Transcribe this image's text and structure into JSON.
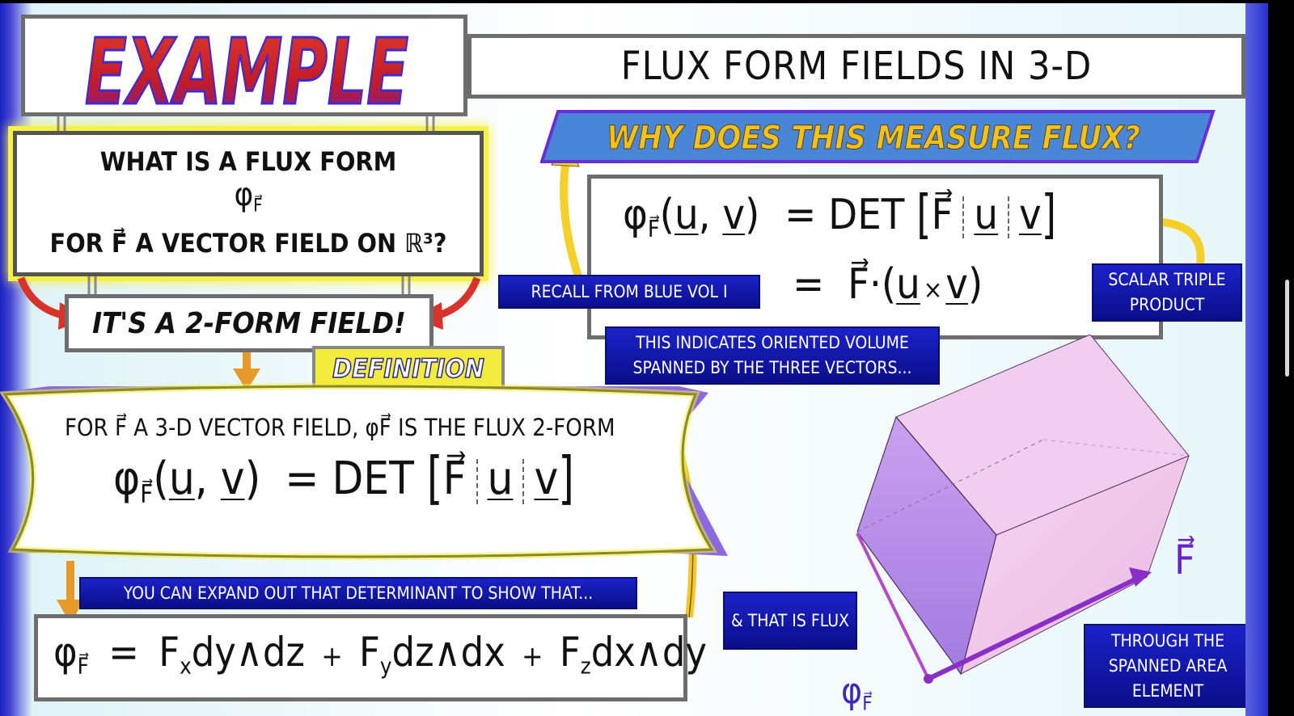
{
  "title_banner": {
    "logo_word": "EXAMPLE",
    "title": "FLUX FORM FIELDS IN 3-D"
  },
  "question": {
    "line1": "WHAT IS A FLUX FORM",
    "symbol": "φ",
    "symbol_sub": "F⃗",
    "line3": "FOR F⃗ A VECTOR FIELD ON ℝ³?"
  },
  "answer": "IT'S A 2-FORM FIELD!",
  "definition_tag": "DEFINITION",
  "definition": {
    "sentence": "FOR F⃗ A 3-D VECTOR FIELD, φF⃗ IS THE FLUX 2-FORM",
    "formula_lhs": "φ",
    "formula_sub": "F⃗",
    "formula_args_open": "(",
    "formula_u": "u",
    "formula_comma": ",",
    "formula_v": "v",
    "formula_args_close": ")",
    "formula_eq": "= DET",
    "formula_F": "F⃗"
  },
  "expand_note": "YOU CAN EXPAND OUT THAT DETERMINANT TO SHOW THAT...",
  "expansion": {
    "phi": "φ",
    "sub": "F⃗",
    "eq": "=",
    "t1_F": "F",
    "t1_sub": "x",
    "t1_rest": "dy∧dz",
    "plus1": "+",
    "t2_F": "F",
    "t2_sub": "y",
    "t2_rest": "dz∧dx",
    "plus2": "+",
    "t3_F": "F",
    "t3_sub": "z",
    "t3_rest": "dx∧dy"
  },
  "why_banner": "WHY DOES THIS MEASURE FLUX?",
  "why_box": {
    "line1_lhs": "φ",
    "line1_sub": "F⃗",
    "line1_args": "(u, v)",
    "line1_eq": "= DET",
    "line1_F": "F⃗",
    "line1_u": "u",
    "line1_v": "v",
    "line2_eq": "=",
    "line2_F": "F⃗",
    "line2_dot": "·",
    "line2_open": "(",
    "line2_u": "u",
    "line2_cross": "×",
    "line2_v": "v",
    "line2_close": ")"
  },
  "recall_label": "RECALL FROM BLUE VOL I",
  "scalar_triple_label": "SCALAR TRIPLE PRODUCT",
  "oriented_volume_label": "THIS INDICATES ORIENTED VOLUME SPANNED BY THE THREE VECTORS...",
  "flux_label": "& THAT IS FLUX",
  "through_label": "THROUGH THE SPANNED AREA ELEMENT",
  "figure_labels": {
    "F": "F⃗",
    "phi": "φ",
    "phi_sub": "F⃗"
  },
  "colors": {
    "title_red": "#d41f1f",
    "banner_blue": "#4a86d8",
    "banner_text": "#f2c21a",
    "label_blue": "#1118b0",
    "arrow_orange": "#e69a2a",
    "arrow_yellow": "#f5d02a",
    "arrow_red": "#d8332a",
    "solid_pink": "#f2c6ea",
    "solid_purple": "#b98ce6"
  }
}
